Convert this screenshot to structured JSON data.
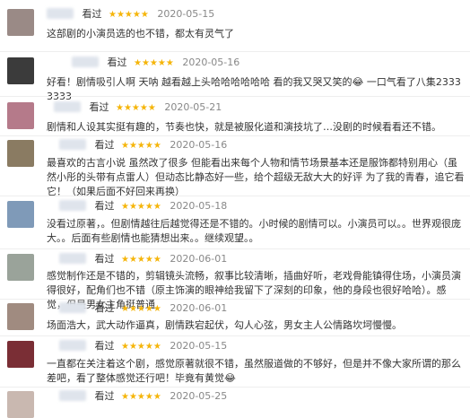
{
  "comments": [
    {
      "seen": "看过",
      "stars": "★★★★★",
      "date": "2020-05-15",
      "avatar_color": "#9a8a86",
      "text": "这部剧的小演员选的也不错，都太有灵气了"
    },
    {
      "seen": "看过",
      "stars": "★★★★★",
      "date": "2020-05-16",
      "avatar_color": "#3b3b3b",
      "text": "好看！剧情吸引人啊 天呐 越看越上头哈哈哈哈哈哈 看的我又哭又笑的😂 一口气看了八集23333333"
    },
    {
      "seen": "看过",
      "stars": "★★★★★",
      "date": "2020-05-21",
      "avatar_color": "#b57a8a",
      "text": "剧情和人设其实挺有趣的，节奏也快，就是被服化道和演技坑了…没剧的时候看看还不错。"
    },
    {
      "seen": "看过",
      "stars": "★★★★★",
      "date": "2020-05-16",
      "avatar_color": "#8a7b62",
      "text": "最喜欢的古言小说 虽然改了很多 但能看出来每个人物和情节场景基本还是服饰都特别用心（虽然小彤的头带有点雷人）但动态比静态好一些，给个超级无敌大大的好评 为了我的青春，追它看它！（如果后面不好回来再换）"
    },
    {
      "seen": "看过",
      "stars": "★★★★★",
      "date": "2020-05-18",
      "avatar_color": "#7f9ab8",
      "text": "没看过原著，。但剧情越往后越觉得还是不错的。小时候的剧情可以。小演员可以。。世界观很庞大。。后面有些剧情也能猜想出来。。继续观望。。"
    },
    {
      "seen": "看过",
      "stars": "★★★★★",
      "date": "2020-06-01",
      "avatar_color": "#9aa39a",
      "text": "感觉制作还是不错的，剪辑镜头流畅，叙事比较清晰，插曲好听，老戏骨能镇得住场，小演员演得很好，配角们也不错（原主饰演的眼神给我留下了深刻的印象，他的身段也很好哈哈）。感觉，但是男女主角挺普通"
    },
    {
      "seen": "看过",
      "stars": "★★★★★",
      "date": "2020-06-01",
      "avatar_color": "#a08b80",
      "text": "场面浩大，武大动作逼真，剧情跌宕起伏，勾人心弦，男女主人公情路坎坷慢慢。"
    },
    {
      "seen": "看过",
      "stars": "★★★★★",
      "date": "2020-05-15",
      "avatar_color": "#7a2e35",
      "text": "一直都在关注着这个剧，感觉原著就很不错，虽然服道做的不够好，但是并不像大家所谓的那么差吧，看了整体感觉还行吧！毕竟有黄觉😂"
    },
    {
      "seen": "看过",
      "stars": "★★★★★",
      "date": "2020-05-25",
      "avatar_color": "#c9b8b0",
      "text": ""
    }
  ]
}
